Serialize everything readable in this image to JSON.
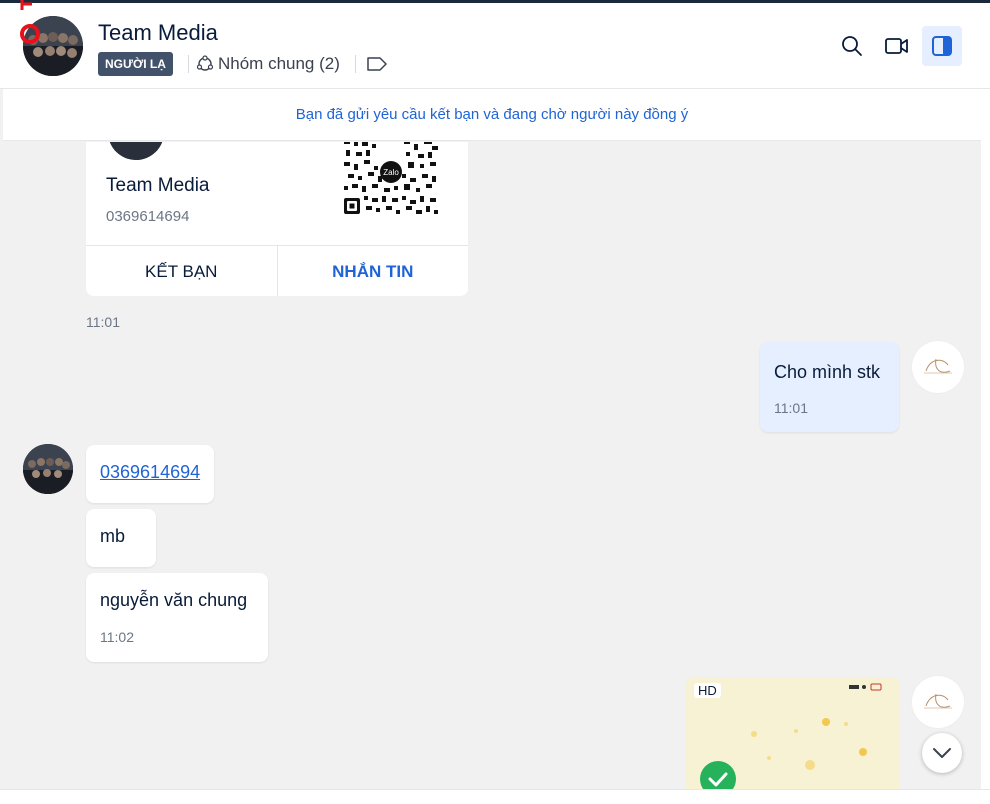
{
  "header": {
    "title": "Team Media",
    "badge": "NGƯỜI LẠ",
    "groups_label": "Nhóm chung (2)",
    "icons": [
      "search-icon",
      "video-call-icon",
      "side-panel-icon",
      "tag-icon",
      "group-icon"
    ]
  },
  "banner": {
    "text": "Bạn đã gửi yêu cầu kết bạn và đang chờ người này đồng ý"
  },
  "contact_card": {
    "name": "Team Media",
    "phone": "0369614694",
    "add_friend_label": "KẾT BẠN",
    "message_label": "NHẮN TIN",
    "qr_logo_text": "Zalo",
    "time": "11:01"
  },
  "messages": [
    {
      "from": "me",
      "text": "Cho mình stk",
      "time": "11:01"
    },
    {
      "from": "them",
      "text": "0369614694"
    },
    {
      "from": "them",
      "text": "mb"
    },
    {
      "from": "them",
      "text": "nguyễn văn chung",
      "time": "11:02"
    },
    {
      "from": "me",
      "type": "image",
      "badge": "HD"
    }
  ],
  "colors": {
    "accent": "#1f64d6",
    "outgoing_bubble": "#e5efff",
    "badge_bg": "#42526b",
    "chat_bg": "#f1f1f1"
  }
}
